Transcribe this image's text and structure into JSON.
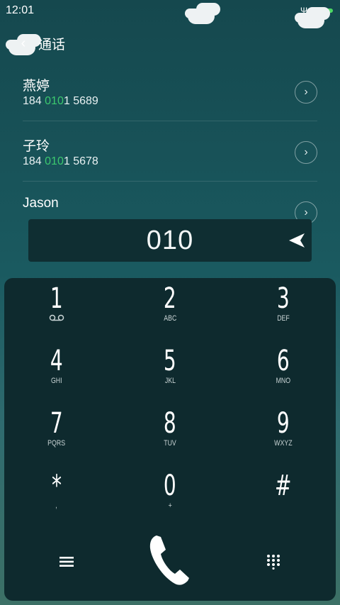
{
  "status": {
    "time": "12:01"
  },
  "header": {
    "title": "通话"
  },
  "contacts": [
    {
      "name": "燕婷",
      "number_prefix": "184 ",
      "number_match": "010",
      "number_suffix": "1 5689"
    },
    {
      "name": "子玲",
      "number_prefix": "184 ",
      "number_match": "010",
      "number_suffix": "1 5678"
    },
    {
      "name": "Jason"
    }
  ],
  "dialer": {
    "input_value": "010",
    "keys": [
      {
        "digit": "1",
        "letters": ""
      },
      {
        "digit": "2",
        "letters": "ABC"
      },
      {
        "digit": "3",
        "letters": "DEF"
      },
      {
        "digit": "4",
        "letters": "GHI"
      },
      {
        "digit": "5",
        "letters": "JKL"
      },
      {
        "digit": "6",
        "letters": "MNO"
      },
      {
        "digit": "7",
        "letters": "PQRS"
      },
      {
        "digit": "8",
        "letters": "TUV"
      },
      {
        "digit": "9",
        "letters": "WXYZ"
      },
      {
        "digit": "*",
        "letters": ","
      },
      {
        "digit": "0",
        "letters": "+"
      },
      {
        "digit": "#",
        "letters": ""
      }
    ]
  },
  "colors": {
    "highlight": "#3cc86e",
    "keypad_bg": "#0e2a2e",
    "input_bg": "#0f2e32"
  },
  "icons": {
    "back": "back-arrow-icon",
    "row_action": "chevron-right-icon",
    "delete": "backspace-icon",
    "voicemail": "voicemail-icon",
    "menu": "menu-icon",
    "call": "phone-handset-icon",
    "keypad_toggle": "dialpad-icon"
  }
}
